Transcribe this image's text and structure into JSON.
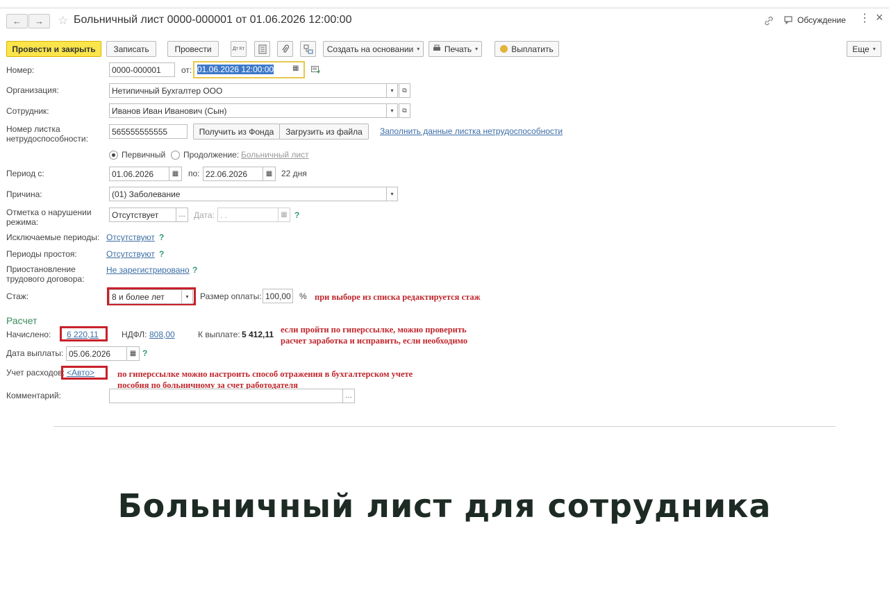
{
  "window": {
    "title": "Больничный лист 0000-000001 от 01.06.2026 12:00:00",
    "discussion_label": "Обсуждение",
    "back_icon": "←",
    "forward_icon": "→",
    "star_icon": "☆",
    "link_icon": "🔗",
    "more_icon": "⋮",
    "close_icon": "×"
  },
  "toolbar": {
    "post_close_label": "Провести и закрыть",
    "save_label": "Записать",
    "post_label": "Провести",
    "dtkt_label": "Дт Кт",
    "create_based_label": "Создать на основании",
    "print_label": "Печать",
    "pay_label": "Выплатить",
    "more_label": "Еще"
  },
  "form": {
    "number_label": "Номер:",
    "number_value": "0000-000001",
    "from_label": "от:",
    "date_value": "01.06.2026 12:00:00",
    "org_label": "Организация:",
    "org_value": "Нетипичный Бухгалтер ООО",
    "employee_label": "Сотрудник:",
    "employee_value": "Иванов Иван Иванович (Сын)",
    "sheet_number_label_1": "Номер листка",
    "sheet_number_label_2": "нетрудоспособности:",
    "sheet_number_value": "565555555555",
    "get_from_fund_label": "Получить из Фонда",
    "load_from_file_label": "Загрузить из файла",
    "fill_data_link": "Заполнить данные листка нетрудоспособности",
    "primary_label": "Первичный",
    "continuation_label": "Продолжение:",
    "continuation_link": "Больничный лист",
    "period_label": "Период с:",
    "period_from": "01.06.2026",
    "period_to_label": "по:",
    "period_to": "22.06.2026",
    "period_days": "22 дня",
    "reason_label": "Причина:",
    "reason_value": "(01) Заболевание",
    "violation_label_1": "Отметка о нарушении",
    "violation_label_2": "режима:",
    "violation_value": "Отсутствует",
    "violation_date_label": "Дата:",
    "violation_date_value": " .  .",
    "excluded_label": "Исключаемые периоды:",
    "excluded_link": "Отсутствуют",
    "downtime_label": "Периоды простоя:",
    "downtime_link": "Отсутствуют",
    "suspension_label_1": "Приостановление",
    "suspension_label_2": "трудового договора:",
    "suspension_link": "Не зарегистрировано",
    "experience_label": "Стаж:",
    "experience_value": "8 и более лет",
    "payment_size_label": "Размер оплаты:",
    "payment_size_value": "100,00",
    "percent_sign": "%",
    "question_mark": "?"
  },
  "calc": {
    "section_title": "Расчет",
    "accrued_label": "Начислено:",
    "accrued_link": "6 220,11",
    "ndfl_label": "НДФЛ:",
    "ndfl_link": "808,00",
    "to_pay_label": "К выплате:",
    "to_pay_value": "5 412,11",
    "pay_date_label": "Дата выплаты:",
    "pay_date_value": "05.06.2026",
    "expense_label": "Учет расходов:",
    "expense_link": "<Авто>",
    "comment_label": "Комментарий:",
    "comment_value": ""
  },
  "annotations": {
    "experience_note": "при выборе из списка редактируется стаж",
    "accrued_note_1": "если пройти по гиперссылке, можно проверить",
    "accrued_note_2": "расчет заработка и исправить, если необходимо",
    "expense_note_1": "по гиперссылке можно настроить способ отражения в бухгалтерском учете",
    "expense_note_2": "пособия по больничному за счет работодателя"
  },
  "caption": "Больничный лист для сотрудника",
  "colors": {
    "primary_button": "#fbe54b",
    "annotation_red": "#c0272d",
    "section_green": "#3a8c5c"
  }
}
